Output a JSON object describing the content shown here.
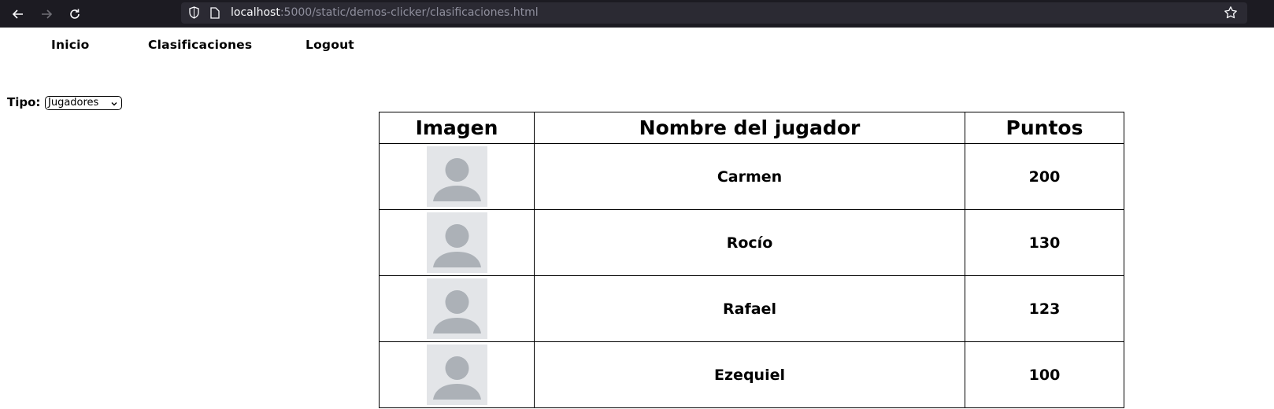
{
  "browser": {
    "url_host": "localhost",
    "url_path": ":5000/static/demos-clicker/clasificaciones.html"
  },
  "nav": {
    "items": [
      {
        "label": "Inicio"
      },
      {
        "label": "Clasificaciones"
      },
      {
        "label": "Logout"
      }
    ]
  },
  "filter": {
    "label": "Tipo:",
    "selected": "Jugadores"
  },
  "table": {
    "headers": [
      "Imagen",
      "Nombre del jugador",
      "Puntos"
    ],
    "rows": [
      {
        "name": "Carmen",
        "points": "200"
      },
      {
        "name": "Rocío",
        "points": "130"
      },
      {
        "name": "Rafael",
        "points": "123"
      },
      {
        "name": "Ezequiel",
        "points": "100"
      }
    ]
  }
}
